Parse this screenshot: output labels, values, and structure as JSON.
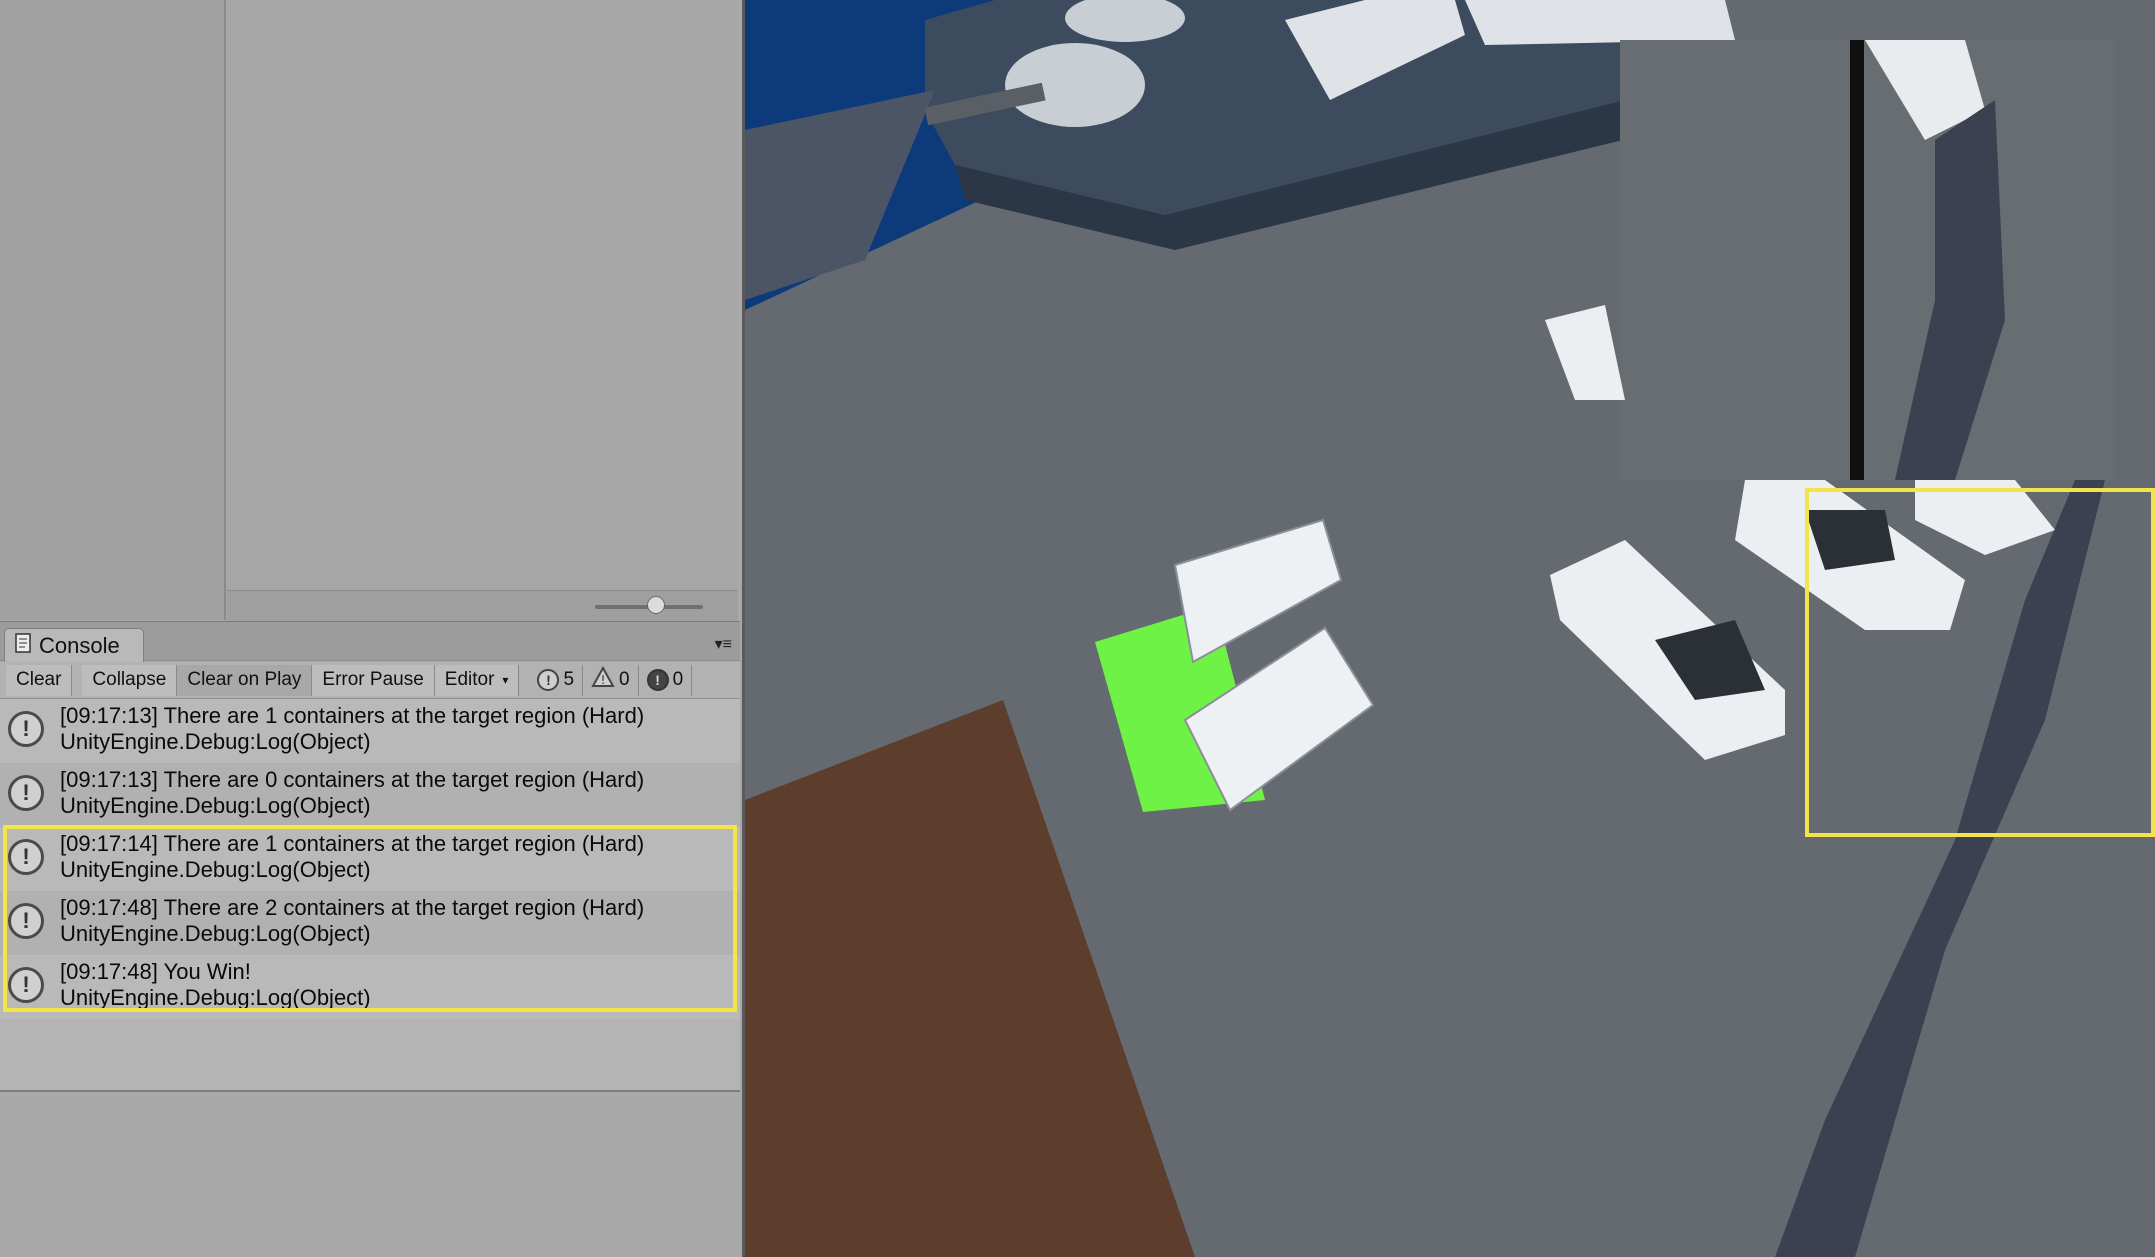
{
  "console": {
    "tab_label": "Console",
    "toolbar": {
      "clear": "Clear",
      "collapse": "Collapse",
      "clear_on_play": "Clear on Play",
      "error_pause": "Error Pause",
      "editor": "Editor",
      "info_count": "5",
      "warning_count": "0",
      "error_count": "0"
    },
    "logs": [
      {
        "line1": "[09:17:13] There are 1 containers at the target region (Hard)",
        "line2": "UnityEngine.Debug:Log(Object)"
      },
      {
        "line1": "[09:17:13] There are 0 containers at the target region (Hard)",
        "line2": "UnityEngine.Debug:Log(Object)"
      },
      {
        "line1": "[09:17:14] There are 1 containers at the target region (Hard)",
        "line2": "UnityEngine.Debug:Log(Object)"
      },
      {
        "line1": "[09:17:48] There are 2 containers at the target region (Hard)",
        "line2": "UnityEngine.Debug:Log(Object)"
      },
      {
        "line1": "[09:17:48] You Win!",
        "line2": "UnityEngine.Debug:Log(Object)"
      }
    ]
  },
  "colors": {
    "highlight": "#f2e54a",
    "target_region": "#6ff246",
    "ground": "#656a70",
    "water": "#0d3a7a",
    "brown_area": "#5d3d2b"
  }
}
